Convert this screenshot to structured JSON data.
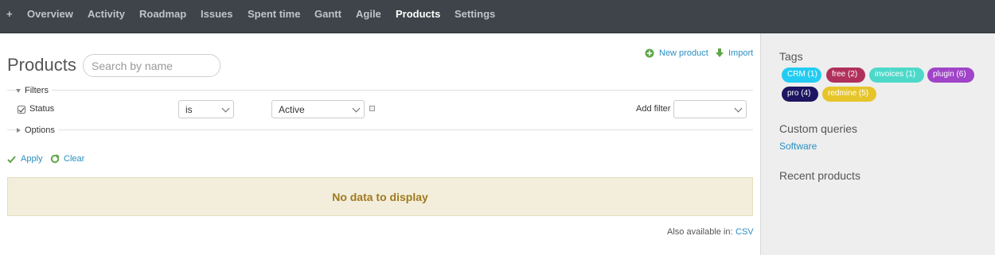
{
  "topnav": {
    "new_icon": "+",
    "items": [
      "Overview",
      "Activity",
      "Roadmap",
      "Issues",
      "Spent time",
      "Gantt",
      "Agile",
      "Products",
      "Settings"
    ],
    "selected": "Products"
  },
  "main": {
    "title": "Products",
    "search_placeholder": "Search by name",
    "actions": {
      "new_product": "New product",
      "import": "Import"
    },
    "filters": {
      "legend": "Filters",
      "status_label": "Status",
      "status_checked": true,
      "operator": "is",
      "value": "Active",
      "add_filter_label": "Add filter",
      "add_filter_value": ""
    },
    "options_legend": "Options",
    "apply": "Apply",
    "clear": "Clear",
    "nodata": "No data to display",
    "also_available": "Also available in:",
    "csv": "CSV"
  },
  "sidebar": {
    "tags_title": "Tags",
    "tags": [
      {
        "label": "CRM (1)",
        "color": "#22ccf2"
      },
      {
        "label": "free (2)",
        "color": "#b0305c"
      },
      {
        "label": "invoices (1)",
        "color": "#4dd9c9"
      },
      {
        "label": "plugin (6)",
        "color": "#a044c8"
      },
      {
        "label": "pro (4)",
        "color": "#1d1561"
      },
      {
        "label": "redmine (5)",
        "color": "#e6c52a"
      }
    ],
    "custom_queries_title": "Custom queries",
    "custom_queries": [
      "Software"
    ],
    "recent_title": "Recent products"
  },
  "colors": {
    "topnav_bg": "#3e4449",
    "link": "#2a8fc1",
    "nodata_bg": "#f2eedb",
    "nodata_text": "#a1791f",
    "sidebar_bg": "#eeeeee"
  }
}
